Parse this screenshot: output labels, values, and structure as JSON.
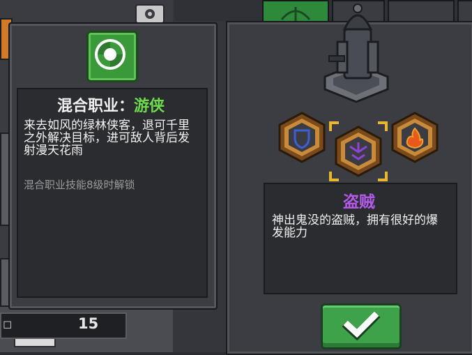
{
  "tooltip": {
    "title_prefix": "混合职业：",
    "title_class": "游侠",
    "description": "来去如风的绿林侠客，退可千里之外解决目标，进可敌人背后发射漫天花雨",
    "unlock_note": "混合职业技能8级时解锁",
    "icon": "swirl-wind-icon"
  },
  "selected_class": {
    "name": "盗贼",
    "description": "神出鬼没的盗贼，拥有很好的爆发能力"
  },
  "class_options": [
    {
      "icon": "shield-icon",
      "selected": false
    },
    {
      "icon": "rogue-sigil-icon",
      "selected": true
    },
    {
      "icon": "fire-icon",
      "selected": false
    }
  ],
  "stat": {
    "value": "15"
  },
  "colors": {
    "ranger_green": "#6cdc4c",
    "rogue_purple": "#b45ae8",
    "confirm_green": "#3da24a",
    "hex_gold": "#c98a3a"
  }
}
